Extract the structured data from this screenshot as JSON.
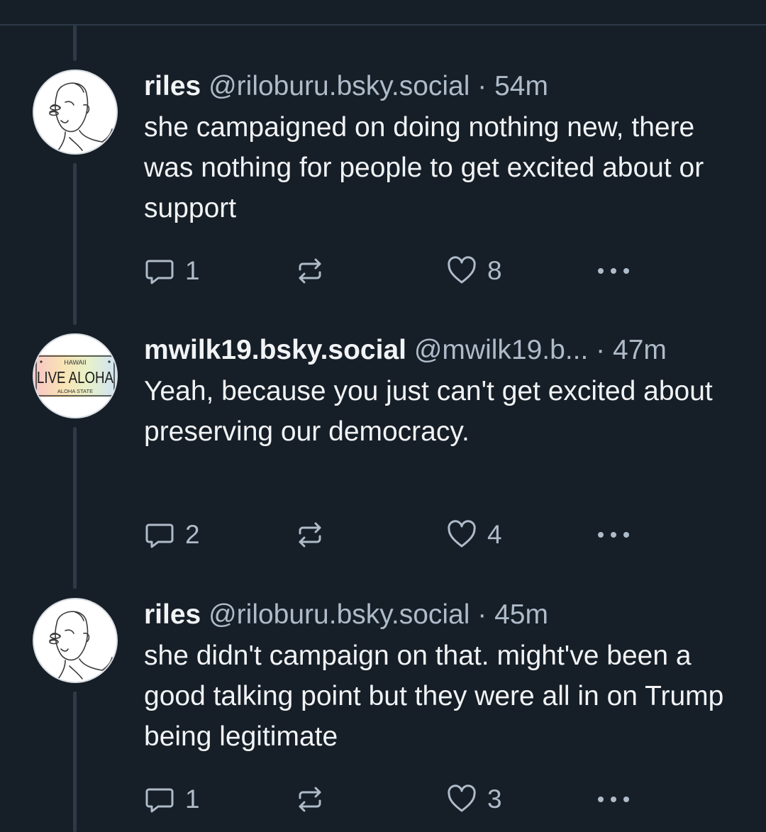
{
  "colors": {
    "background": "#161e27",
    "divider": "#2e3a48",
    "text_primary": "#f1f3f5",
    "text_secondary": "#aebbc9"
  },
  "posts": [
    {
      "avatar_icon": "sketch-portrait-avatar",
      "author_name": "riles",
      "author_handle": "@riloburu.bsky.social",
      "separator": "·",
      "timestamp": "54m",
      "text": "she campaigned on doing nothing new, there was nothing for people to get excited about or support",
      "reply_count": "1",
      "repost_count": "",
      "like_count": "8"
    },
    {
      "avatar_icon": "license-plate-avatar",
      "avatar_text": {
        "state": "HAWAII",
        "slogan": "LIVE ALOHA",
        "motto": "ALOHA STATE"
      },
      "author_name": "mwilk19.bsky.social",
      "author_handle": "@mwilk19.b...",
      "separator": "·",
      "timestamp": "47m",
      "text": "Yeah, because you just can't get excited about preserving our democracy.",
      "reply_count": "2",
      "repost_count": "",
      "like_count": "4"
    },
    {
      "avatar_icon": "sketch-portrait-avatar",
      "author_name": "riles",
      "author_handle": "@riloburu.bsky.social",
      "separator": "·",
      "timestamp": "45m",
      "text": "she didn't campaign on that. might've been a good talking point but they were all in on Trump being legitimate",
      "reply_count": "1",
      "repost_count": "",
      "like_count": "3"
    }
  ]
}
